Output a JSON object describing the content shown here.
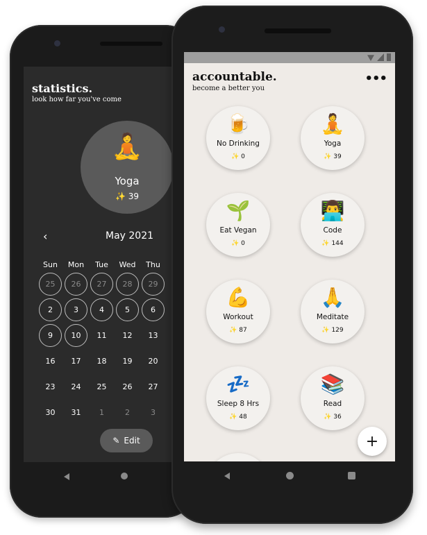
{
  "stats": {
    "title": "statistics.",
    "subtitle": "look how far you've come",
    "focus": {
      "emoji": "🧘",
      "name": "Yoga",
      "count": "✨ 39"
    },
    "calendar": {
      "prev_icon": "‹",
      "month": "May 2021",
      "weekdays": [
        "Sun",
        "Mon",
        "Tue",
        "Wed",
        "Thu"
      ],
      "rows": [
        [
          "25",
          "26",
          "27",
          "28",
          "29"
        ],
        [
          "2",
          "3",
          "4",
          "5",
          "6"
        ],
        [
          "9",
          "10",
          "11",
          "12",
          "13"
        ],
        [
          "16",
          "17",
          "18",
          "19",
          "20"
        ],
        [
          "23",
          "24",
          "25",
          "26",
          "27"
        ],
        [
          "30",
          "31",
          "1",
          "2",
          "3"
        ]
      ]
    },
    "edit_label": "Edit",
    "edit_icon": "✎"
  },
  "app": {
    "title": "accountable.",
    "subtitle": "become a better you",
    "menu_icon": "•••",
    "fab_label": "+",
    "habits": [
      {
        "emoji": "🍺",
        "name": "No Drinking",
        "count": "✨ 0"
      },
      {
        "emoji": "🧘",
        "name": "Yoga",
        "count": "✨ 39"
      },
      {
        "emoji": "🌱",
        "name": "Eat Vegan",
        "count": "✨ 0"
      },
      {
        "emoji": "👨‍💻",
        "name": "Code",
        "count": "✨ 144"
      },
      {
        "emoji": "💪",
        "name": "Workout",
        "count": "✨ 87"
      },
      {
        "emoji": "🙏",
        "name": "Meditate",
        "count": "✨ 129"
      },
      {
        "emoji": "💤",
        "name": "Sleep 8 Hrs",
        "count": "✨ 48"
      },
      {
        "emoji": "📚",
        "name": "Read",
        "count": "✨ 36"
      }
    ]
  }
}
